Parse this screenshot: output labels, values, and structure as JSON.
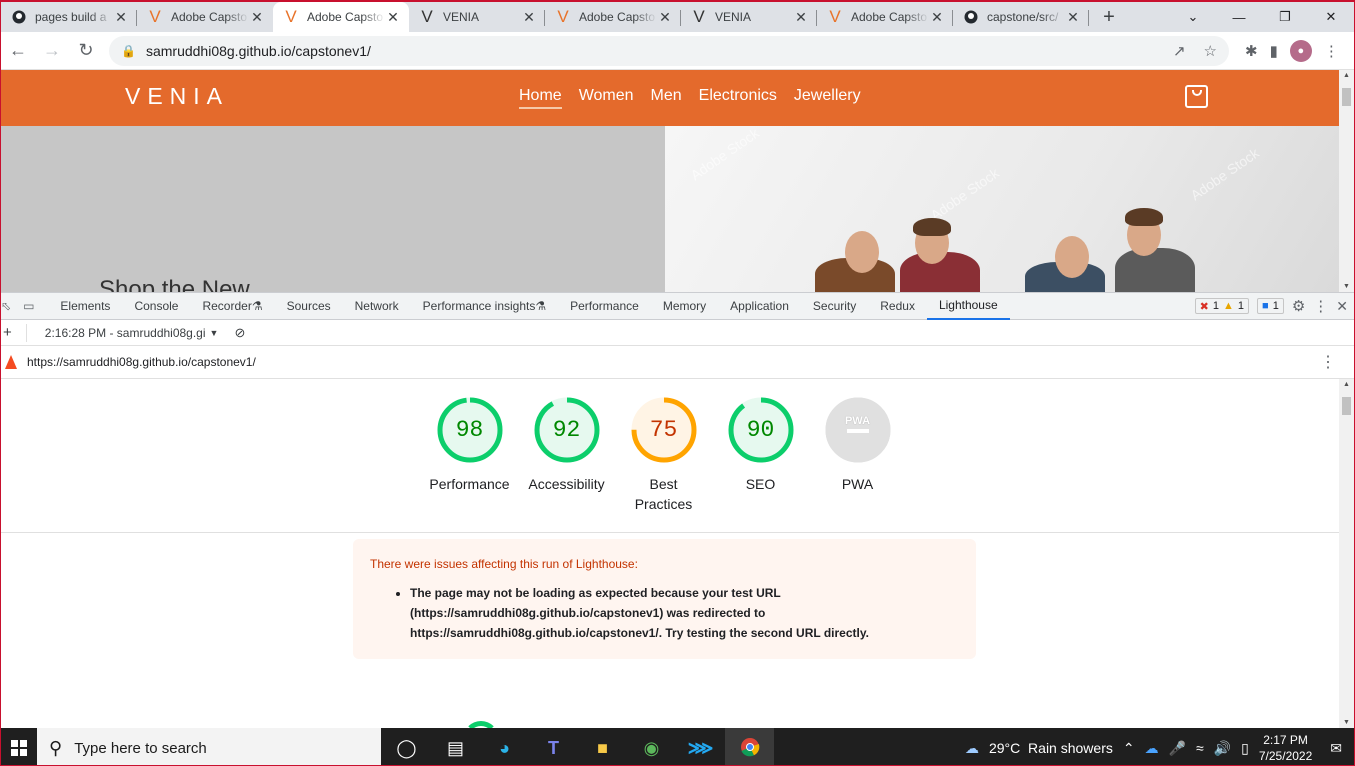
{
  "tabs": [
    {
      "title": "pages build a",
      "icon": "github-icon"
    },
    {
      "title": "Adobe Capsto",
      "icon": "venia-v-icon"
    },
    {
      "title": "Adobe Capsto",
      "icon": "venia-v-icon",
      "active": true
    },
    {
      "title": "VENIA",
      "icon": "venia-v-dark-icon"
    },
    {
      "title": "Adobe Capsto",
      "icon": "venia-v-icon"
    },
    {
      "title": "VENIA",
      "icon": "venia-v-dark-icon"
    },
    {
      "title": "Adobe Capsto",
      "icon": "venia-v-icon"
    },
    {
      "title": "capstone/src/",
      "icon": "github-icon"
    }
  ],
  "address": {
    "url": "samruddhi08g.github.io/capstonev1/"
  },
  "site": {
    "logo": "VENIA",
    "nav": [
      "Home",
      "Women",
      "Men",
      "Electronics",
      "Jewellery"
    ],
    "hero_text": "Shop the New",
    "watermark": "Adobe Stock"
  },
  "devtools": {
    "tabs": [
      "Elements",
      "Console",
      "Recorder",
      "Sources",
      "Network",
      "Performance insights",
      "Performance",
      "Memory",
      "Application",
      "Security",
      "Redux",
      "Lighthouse"
    ],
    "active_tab": "Lighthouse",
    "errors": "1",
    "warnings": "1",
    "messages": "1",
    "report_select": "2:16:28 PM - samruddhi08g.gi",
    "report_url": "https://samruddhi08g.github.io/capstonev1/"
  },
  "lighthouse": {
    "scores": [
      {
        "label": "Performance",
        "score": 98,
        "color": "#0cce6b",
        "text": "#008800",
        "bg": "#e6f9ef"
      },
      {
        "label": "Accessibility",
        "score": 92,
        "color": "#0cce6b",
        "text": "#008800",
        "bg": "#e6f9ef"
      },
      {
        "label": "Best Practices",
        "score": 75,
        "color": "#ffa400",
        "text": "#c33300",
        "bg": "#fff4e5"
      },
      {
        "label": "SEO",
        "score": 90,
        "color": "#0cce6b",
        "text": "#008800",
        "bg": "#e6f9ef"
      },
      {
        "label": "PWA",
        "score": null,
        "badge": "PWA",
        "color": "#e0e0e0",
        "text": "#9e9e9e",
        "bg": "#e0e0e0"
      }
    ],
    "warning_title": "There were issues affecting this run of Lighthouse:",
    "warning_lines": [
      "The page may not be loading as expected because your test URL",
      "(https://samruddhi08g.github.io/capstonev1) was redirected to",
      "https://samruddhi08g.github.io/capstonev1/. Try testing the second URL directly."
    ]
  },
  "taskbar": {
    "search_placeholder": "Type here to search",
    "weather": "29°C  Rain showers",
    "time": "2:17 PM",
    "date": "7/25/2022"
  }
}
